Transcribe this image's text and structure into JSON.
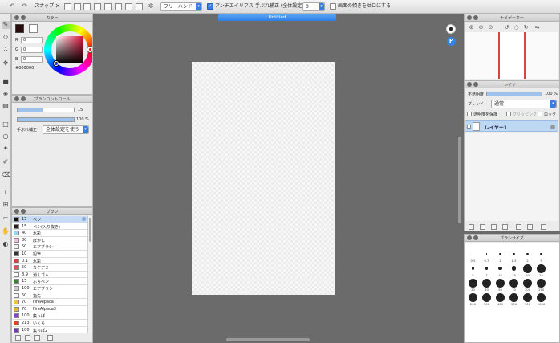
{
  "toolbar": {
    "snap_label": "スナップ",
    "stroke_mode": "フリーハンド",
    "antialias_label": "アンチエイリアス",
    "stabilizer_label": "手ぶれ補正 (全体設定)",
    "stabilizer_value": "0",
    "zero_label": "画面の傾きをゼロにする"
  },
  "canvas": {
    "document_title": "Untitled"
  },
  "color_panel": {
    "title": "カラー",
    "r_label": "R",
    "r": "0",
    "g_label": "G",
    "g": "0",
    "b_label": "B",
    "b": "0",
    "hex": "#000000",
    "fg_color": "#2b0a0a",
    "bg_color": "#ffffff"
  },
  "brush_control": {
    "title": "ブラシコントロール",
    "size_value": "15",
    "opacity_value": "100 %",
    "correction_label": "手ぶれ補正",
    "correction_mode": "全体設定を使う"
  },
  "brush_list": {
    "title": "ブラシ",
    "items": [
      {
        "size": "15",
        "name": "ペン",
        "color": "#111111",
        "selected": true
      },
      {
        "size": "15",
        "name": "ペン(入り抜き)",
        "color": "#222222"
      },
      {
        "size": "40",
        "name": "水彩",
        "color": "#8fd6f0"
      },
      {
        "size": "80",
        "name": "ぼかし",
        "color": "#f0c0e0"
      },
      {
        "size": "50",
        "name": "エアブラシ",
        "color": "#eeeeee"
      },
      {
        "size": "10",
        "name": "鉛筆",
        "color": "#333333"
      },
      {
        "size": "0.1",
        "name": "水彩",
        "color": "#cc4444"
      },
      {
        "size": "50",
        "name": "カケアミ",
        "color": "#e05050"
      },
      {
        "size": "8.9",
        "name": "消しゴム",
        "color": "#ffffff"
      },
      {
        "size": "15",
        "name": "ぶちペン",
        "color": "#2a8a2a"
      },
      {
        "size": "100",
        "name": "エアブラシ",
        "color": "#cccccc"
      },
      {
        "size": "50",
        "name": "指先",
        "color": "#f6f6f6"
      },
      {
        "size": "70",
        "name": "FireAlpaca",
        "color": "#f0c040"
      },
      {
        "size": "70",
        "name": "FireAlpaca3",
        "color": "#f0b030"
      },
      {
        "size": "100",
        "name": "集っぽ",
        "color": "#8844cc"
      },
      {
        "size": "213",
        "name": "いくら",
        "color": "#dd4422"
      },
      {
        "size": "100",
        "name": "集っぽ2",
        "color": "#7733bb"
      }
    ]
  },
  "navigator": {
    "title": "ナビゲーター"
  },
  "layer_panel": {
    "title": "レイヤー",
    "opacity_label": "不透明度",
    "opacity_value": "100 %",
    "blend_label": "ブレンド",
    "blend_mode": "通常",
    "protect_label": "透明度を保護",
    "clipping_label": "クリッピング",
    "lock_label": "ロック",
    "layer_name": "レイヤー1"
  },
  "brush_size": {
    "title": "ブラシサイズ",
    "sizes": [
      "0.5",
      "0.7",
      "1",
      "1.5",
      "2",
      "3",
      "5",
      "7",
      "10",
      "15",
      "20",
      "25",
      "30",
      "40",
      "50",
      "70",
      "100",
      "150",
      "200",
      "300",
      "400",
      "500",
      "700",
      "1000"
    ]
  }
}
